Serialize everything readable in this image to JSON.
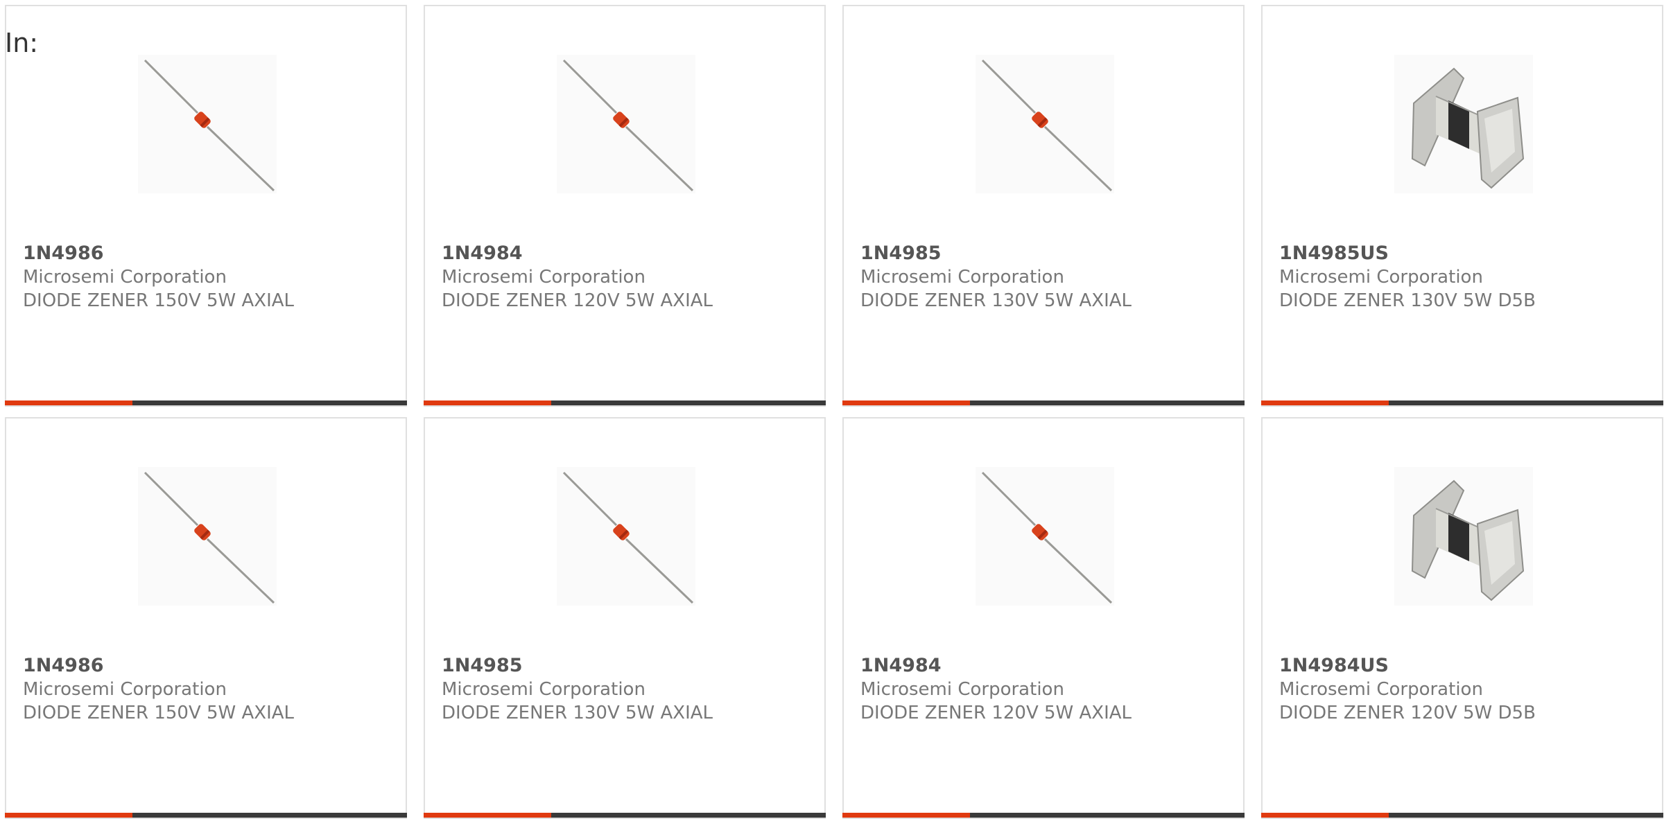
{
  "filter_label": "In:",
  "colors": {
    "accent": "#e03a10",
    "bar_dark": "#3a3a3a",
    "card_border": "#e0e0e0"
  },
  "products": [
    {
      "part": "1N4986",
      "maker": "Microsemi Corporation",
      "desc": "DIODE ZENER 150V 5W AXIAL",
      "image": "axial-diode"
    },
    {
      "part": "1N4984",
      "maker": "Microsemi Corporation",
      "desc": "DIODE ZENER 120V 5W AXIAL",
      "image": "axial-diode"
    },
    {
      "part": "1N4985",
      "maker": "Microsemi Corporation",
      "desc": "DIODE ZENER 130V 5W AXIAL",
      "image": "axial-diode"
    },
    {
      "part": "1N4985US",
      "maker": "Microsemi Corporation",
      "desc": "DIODE ZENER 130V 5W D5B",
      "image": "d5b-package"
    },
    {
      "part": "1N4986",
      "maker": "Microsemi Corporation",
      "desc": "DIODE ZENER 150V 5W AXIAL",
      "image": "axial-diode"
    },
    {
      "part": "1N4985",
      "maker": "Microsemi Corporation",
      "desc": "DIODE ZENER 130V 5W AXIAL",
      "image": "axial-diode"
    },
    {
      "part": "1N4984",
      "maker": "Microsemi Corporation",
      "desc": "DIODE ZENER 120V 5W AXIAL",
      "image": "axial-diode"
    },
    {
      "part": "1N4984US",
      "maker": "Microsemi Corporation",
      "desc": "DIODE ZENER 120V 5W D5B",
      "image": "d5b-package"
    }
  ]
}
